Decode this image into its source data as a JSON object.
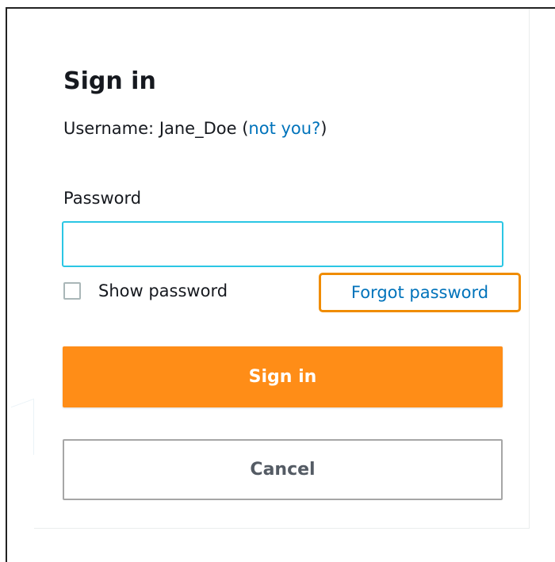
{
  "form": {
    "title": "Sign in",
    "username_prefix": "Username: ",
    "username_value": "Jane_Doe",
    "username_open_paren": " (",
    "not_you_link": "not you?",
    "username_close_paren": ")",
    "password_label": "Password",
    "password_value": "",
    "show_password_label": "Show password",
    "show_password_checked": false,
    "forgot_password_link": "Forgot password",
    "signin_button": "Sign in",
    "cancel_button": "Cancel"
  },
  "colors": {
    "primary_button": "#ff8d17",
    "link": "#0073bb",
    "input_focus_border": "#2bc6e4",
    "highlight_box": "#f08c00"
  }
}
